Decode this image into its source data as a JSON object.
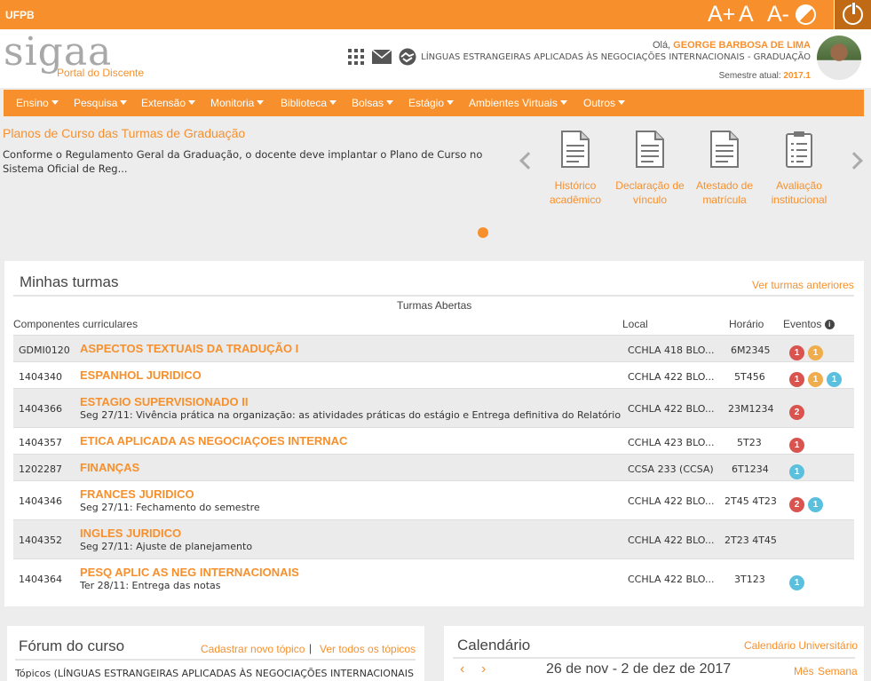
{
  "topbar": {
    "institution": "UFPB",
    "font_increase": "A+",
    "font_normal": "A",
    "font_decrease": "A-"
  },
  "header": {
    "logo": "sigaa",
    "portal": "Portal do Discente",
    "greeting_prefix": "Olá, ",
    "user_name": "GEORGE BARBOSA DE LIMA",
    "course": "LÍNGUAS ESTRANGEIRAS APLICADAS ÀS NEGOCIAÇÕES INTERNACIONAIS - GRADUAÇÃO",
    "semester_label": "Semestre atual: ",
    "semester_value": "2017.1"
  },
  "nav": [
    "Ensino",
    "Pesquisa",
    "Extensão",
    "Monitoria",
    "Biblioteca",
    "Bolsas",
    "Estágio",
    "Ambientes Virtuais",
    "Outros"
  ],
  "news": {
    "title": "Planos de Curso das Turmas de Graduação",
    "text": "Conforme o Regulamento Geral da Graduação, o docente deve implantar o Plano de Curso no Sistema Oficial de Reg..."
  },
  "tiles": [
    {
      "line1": "Histórico",
      "line2": "acadêmico"
    },
    {
      "line1": "Declaração de",
      "line2": "vínculo"
    },
    {
      "line1": "Atestado de",
      "line2": "matrícula"
    },
    {
      "line1": "Avaliação",
      "line2": "institucional"
    }
  ],
  "turmas": {
    "title": "Minhas turmas",
    "prev_link": "Ver turmas anteriores",
    "subtitle": "Turmas Abertas",
    "col_componentes": "Componentes curriculares",
    "col_local": "Local",
    "col_horario": "Horário",
    "col_eventos": "Eventos",
    "rows": [
      {
        "code": "GDMI0120",
        "name": "ASPECTOS TEXTUAIS DA TRADUÇÃO I",
        "note": "",
        "local": "CCHLA 418 BLO...",
        "horario": "6M2345",
        "badges": [
          {
            "n": "1",
            "c": "#d9534f"
          },
          {
            "n": "1",
            "c": "#f0ad4e"
          }
        ]
      },
      {
        "code": "1404340",
        "name": "ESPANHOL JURIDICO",
        "note": "",
        "local": "CCHLA 422 BLO...",
        "horario": "5T456",
        "badges": [
          {
            "n": "1",
            "c": "#d9534f"
          },
          {
            "n": "1",
            "c": "#f0ad4e"
          },
          {
            "n": "1",
            "c": "#5bc0de"
          }
        ]
      },
      {
        "code": "1404366",
        "name": "ESTAGIO SUPERVISIONADO II",
        "note": "Seg 27/11: Vivência prática na organização: as atividades práticas do estágio e Entrega definitiva do Relatório",
        "local": "CCHLA 422 BLO...",
        "horario": "23M1234",
        "badges": [
          {
            "n": "2",
            "c": "#d9534f"
          }
        ]
      },
      {
        "code": "1404357",
        "name": "ETICA APLICADA AS NEGOCIAÇOES INTERNAC",
        "note": "",
        "local": "CCHLA 423 BLO...",
        "horario": "5T23",
        "badges": [
          {
            "n": "1",
            "c": "#d9534f"
          }
        ]
      },
      {
        "code": "1202287",
        "name": "FINANÇAS",
        "note": "",
        "local": "CCSA 233 (CCSA)",
        "horario": "6T1234",
        "badges": [
          {
            "n": "1",
            "c": "#5bc0de"
          }
        ]
      },
      {
        "code": "1404346",
        "name": "FRANCES JURIDICO",
        "note": "Seg 27/11: Fechamento do semestre",
        "local": "CCHLA 422 BLO...",
        "horario": "2T45 4T23",
        "badges": [
          {
            "n": "2",
            "c": "#d9534f"
          },
          {
            "n": "1",
            "c": "#5bc0de"
          }
        ]
      },
      {
        "code": "1404352",
        "name": "INGLES JURIDICO",
        "note": "Seg 27/11: Ajuste de planejamento",
        "local": "CCHLA 422 BLO...",
        "horario": "2T23 4T45",
        "badges": []
      },
      {
        "code": "1404364",
        "name": "PESQ APLIC AS NEG INTERNACIONAIS",
        "note": "Ter 28/11: Entrega das notas",
        "local": "CCHLA 422 BLO...",
        "horario": "3T123",
        "badges": [
          {
            "n": "1",
            "c": "#5bc0de"
          }
        ]
      }
    ]
  },
  "forum": {
    "title": "Fórum do curso",
    "new_topic": "Cadastrar novo tópico",
    "separator": "|",
    "all_topics": "Ver todos os tópicos",
    "topics_text": "Tópicos (LÍNGUAS ESTRANGEIRAS APLICADAS ÀS NEGOCIAÇÕES INTERNACIONAIS"
  },
  "calendar": {
    "title": "Calendário",
    "link": "Calendário Universitário",
    "prev": "‹",
    "next": "›",
    "range": "26 de nov - 2 de dez de 2017",
    "view_month": "Mês",
    "view_week": "Semana"
  },
  "colors": {
    "accent": "#f7902c",
    "danger": "#d9534f",
    "warning": "#f0ad4e",
    "info": "#5bc0de"
  }
}
